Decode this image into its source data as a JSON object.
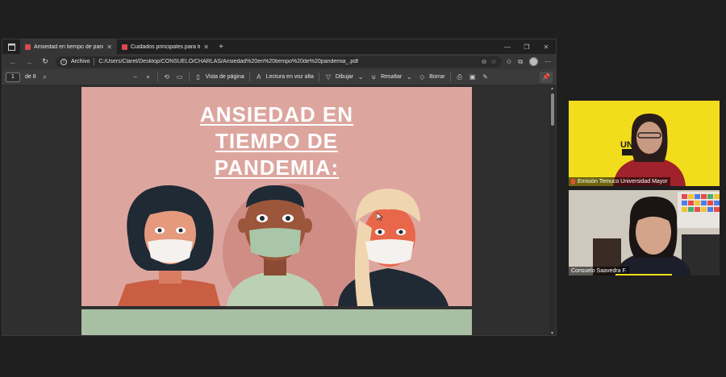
{
  "browser": {
    "tabs": [
      {
        "label": "Ansiedad en tiempo de pandemia",
        "active": true
      },
      {
        "label": "Cuidados principales para tu salud",
        "active": false
      }
    ],
    "address": {
      "label": "Archivo",
      "url": "C:/Users/Claret/Desktop/CONSUELO/CHARLAS/Ansiedad%20en%20tiempo%20de%20pandemia_.pdf"
    }
  },
  "pdf_toolbar": {
    "page_current": "1",
    "page_total": "de 8",
    "page_view": "Vista de página",
    "read_aloud": "Lectura en voz alta",
    "draw": "Dibujar",
    "highlight": "Resaltar",
    "erase": "Borrar"
  },
  "slide": {
    "title_lines": [
      "ANSIEDAD EN",
      "TIEMPO DE",
      "PANDEMIA:"
    ],
    "bg_color": "#dca69f",
    "next_slide_color": "#a9bfa4"
  },
  "participants": [
    {
      "name": "Emisión Temuco Universidad Mayor",
      "bg": "#f2dd1c"
    },
    {
      "name": "Consuelo Saavedra F.",
      "bg": "#d7d2c8"
    }
  ],
  "icons": [
    "back-icon",
    "forward-icon",
    "refresh-icon",
    "info-icon",
    "favorites-icon",
    "collections-icon",
    "profile-icon",
    "more-icon",
    "search-icon",
    "zoom-out-icon",
    "zoom-in-icon",
    "rotate-icon",
    "fit-icon",
    "read-aloud-icon",
    "draw-icon",
    "highlight-icon",
    "erase-icon",
    "print-icon",
    "save-icon",
    "pin-icon"
  ]
}
